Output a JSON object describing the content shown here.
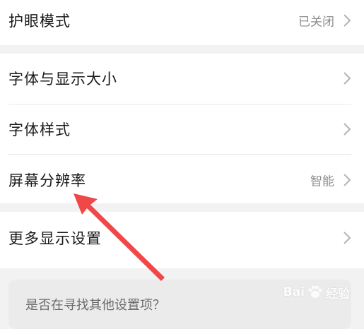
{
  "rows": [
    {
      "label": "护眼模式",
      "value": "已关闭"
    },
    {
      "label": "字体与显示大小",
      "value": ""
    },
    {
      "label": "字体样式",
      "value": ""
    },
    {
      "label": "屏幕分辨率",
      "value": "智能"
    },
    {
      "label": "更多显示设置",
      "value": ""
    }
  ],
  "search_prompt": "是否在寻找其他设置项？",
  "watermark": {
    "brand_left": "Bai",
    "brand_right": "经验",
    "icon": "paw-icon"
  },
  "annotation": {
    "icon": "red-arrow",
    "color": "#f04848"
  },
  "colors": {
    "background": "#f2f2f2",
    "row_background": "#ffffff",
    "value_text": "#8c8c8c",
    "chevron": "#b3b3b3"
  }
}
